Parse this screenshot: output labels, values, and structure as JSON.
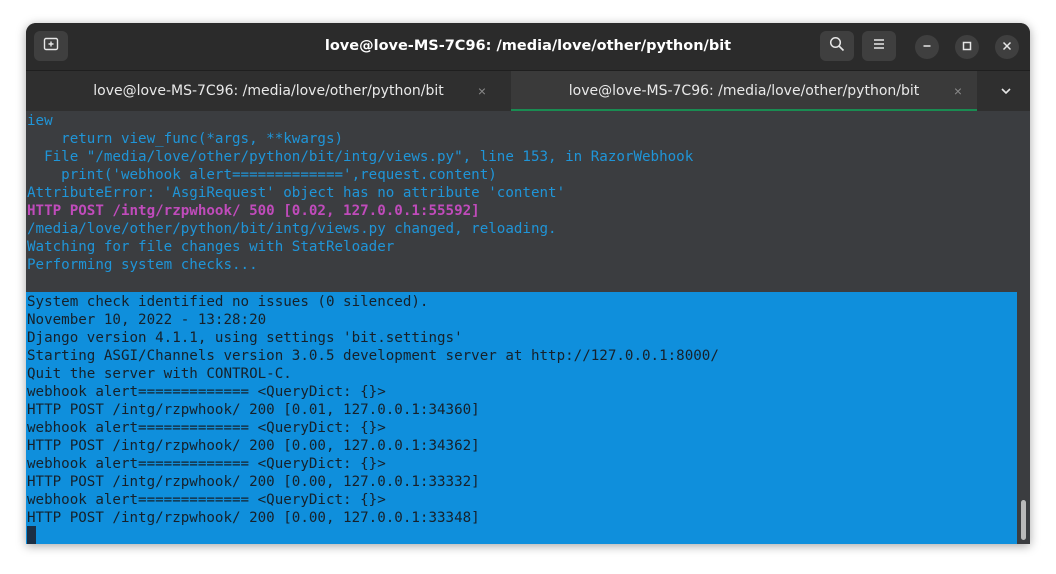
{
  "window": {
    "title": "love@love-MS-7C96: /media/love/other/python/bit"
  },
  "titlebar_buttons": {
    "new_tab_icon": "new-tab-icon",
    "search_icon": "search-icon",
    "menu_icon": "hamburger-menu-icon",
    "minimize_icon": "minimize-icon",
    "maximize_icon": "maximize-icon",
    "close_icon": "close-icon"
  },
  "tabs": [
    {
      "label": "love@love-MS-7C96: /media/love/other/python/bit",
      "close": "×",
      "active": false
    },
    {
      "label": "love@love-MS-7C96: /media/love/other/python/bit",
      "close": "×",
      "active": true
    }
  ],
  "tabs_dropdown_icon": "chevron-down-icon",
  "terminal": {
    "history_lines": [
      {
        "text": "iew",
        "style": "cyan"
      },
      {
        "text": "    return view_func(*args, **kwargs)",
        "style": "cyan"
      },
      {
        "text": "  File \"/media/love/other/python/bit/intg/views.py\", line 153, in RazorWebhook",
        "style": "cyan"
      },
      {
        "text": "    print('webhook alert=============',request.content)",
        "style": "cyan"
      },
      {
        "text": "AttributeError: 'AsgiRequest' object has no attribute 'content'",
        "style": "cyan"
      },
      {
        "text": "HTTP POST /intg/rzpwhook/ 500 [0.02, 127.0.0.1:55592]",
        "style": "magenta"
      },
      {
        "text": "/media/love/other/python/bit/intg/views.py changed, reloading.",
        "style": "cyan"
      },
      {
        "text": "Watching for file changes with StatReloader",
        "style": "cyan"
      },
      {
        "text": "Performing system checks...",
        "style": "cyan"
      }
    ],
    "selected_lines": [
      "System check identified no issues (0 silenced).",
      "November 10, 2022 - 13:28:20",
      "Django version 4.1.1, using settings 'bit.settings'",
      "Starting ASGI/Channels version 3.0.5 development server at http://127.0.0.1:8000/",
      "Quit the server with CONTROL-C.",
      "webhook alert============= <QueryDict: {}>",
      "HTTP POST /intg/rzpwhook/ 200 [0.01, 127.0.0.1:34360]",
      "webhook alert============= <QueryDict: {}>",
      "HTTP POST /intg/rzpwhook/ 200 [0.00, 127.0.0.1:34362]",
      "webhook alert============= <QueryDict: {}>",
      "HTTP POST /intg/rzpwhook/ 200 [0.00, 127.0.0.1:33332]",
      "webhook alert============= <QueryDict: {}>",
      "HTTP POST /intg/rzpwhook/ 200 [0.00, 127.0.0.1:33348]"
    ]
  },
  "colors": {
    "output_text": "#1f95d8",
    "error_status": "#c04bbb",
    "selection": "#0f8fdc",
    "active_tab_indicator": "#1a8c52"
  }
}
